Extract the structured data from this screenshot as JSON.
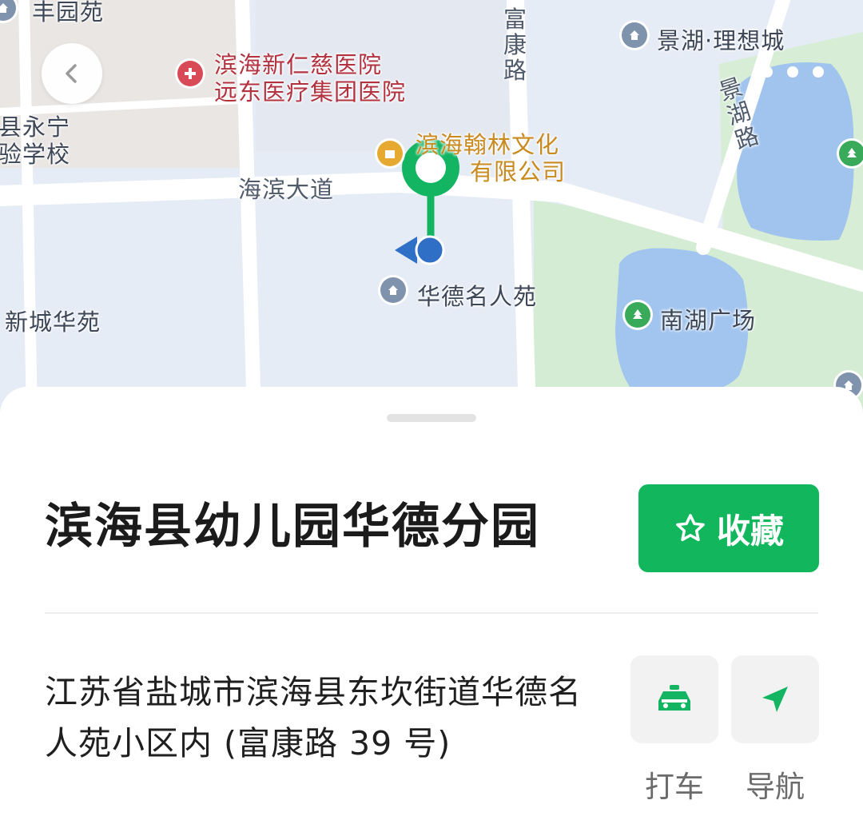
{
  "map": {
    "labels": {
      "fengyuan": "丰园苑",
      "xinrenci": "滨海新仁慈医院",
      "yuandong": "远东医疗集团医院",
      "yongning": "县永宁",
      "school": "验学校",
      "hanlin_1": "滨海翰林文化",
      "hanlin_2": "有限公司",
      "haibin_road": "海滨大道",
      "fukang_road": "富康路",
      "jinghu_road": "景湖路",
      "jinghu_lixiang": "景湖·理想城",
      "huade": "华德名人苑",
      "xincheng": "新城华苑",
      "nanhu": "南湖广场"
    },
    "icons": {
      "back": "chevron-left-icon",
      "more": "more-dots-icon",
      "pin": "location-pin-icon",
      "user": "user-location-icon"
    }
  },
  "place": {
    "title": "滨海县幼儿园华德分园",
    "favorite_label": "收藏",
    "address": "江苏省盐城市滨海县东坎街道华德名人苑小区内 (富康路 39 号)"
  },
  "actions": {
    "taxi_label": "打车",
    "navigate_label": "导航"
  },
  "colors": {
    "accent": "#12b65d",
    "map_background": "#e6ecf5",
    "park": "#d4ecd3",
    "water": "#9fc3ee"
  }
}
